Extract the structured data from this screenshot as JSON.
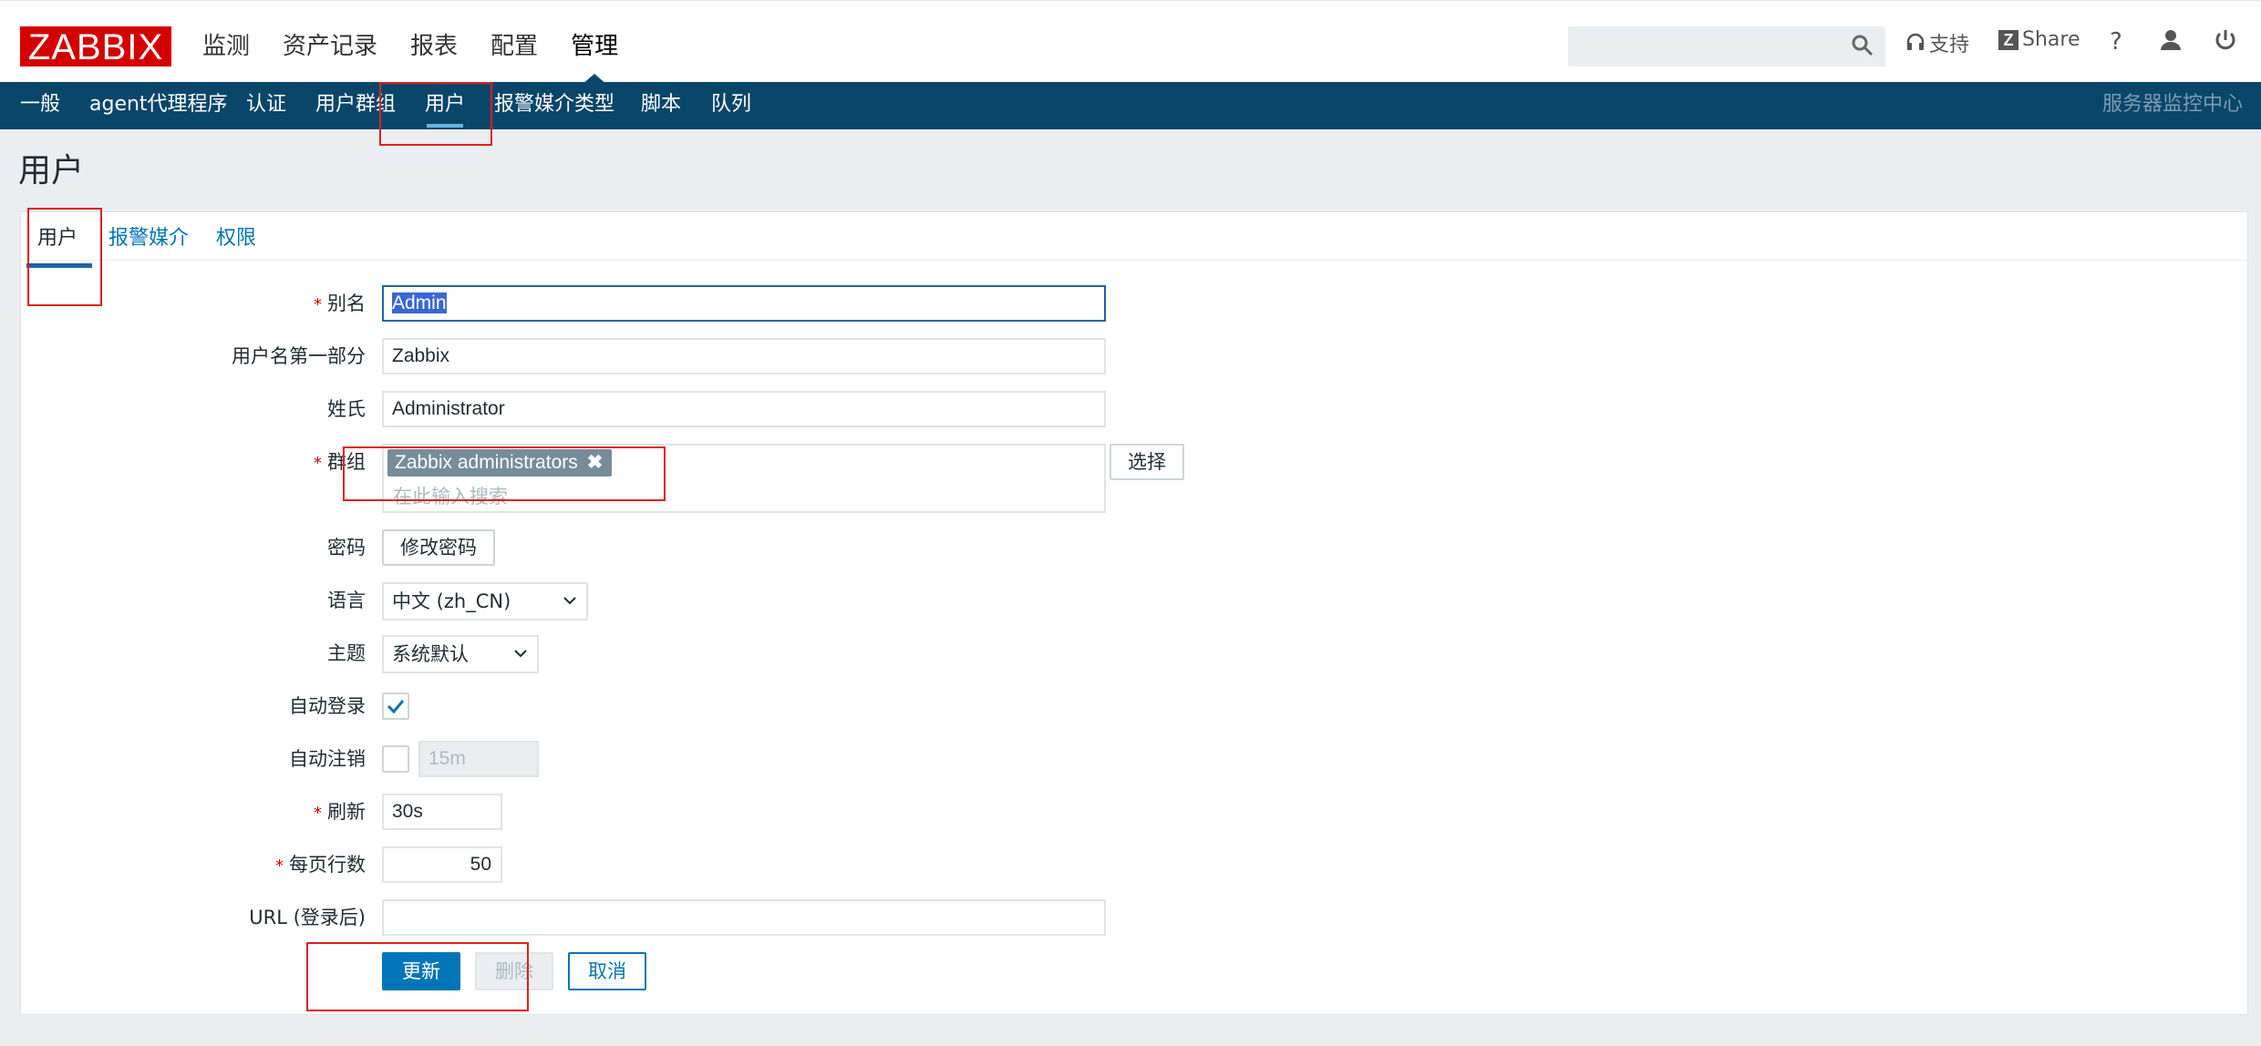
{
  "header": {
    "logo": "ZABBIX",
    "menu": [
      "监测",
      "资产记录",
      "报表",
      "配置",
      "管理"
    ],
    "active_menu": "管理",
    "support": "支持",
    "share": "Share",
    "help": "?"
  },
  "submenu": {
    "items": [
      "一般",
      "agent代理程序",
      "认证",
      "用户群组",
      "用户",
      "报警媒介类型",
      "脚本",
      "队列"
    ],
    "active": "用户",
    "server_name": "服务器监控中心"
  },
  "page": {
    "title": "用户"
  },
  "tabs": [
    "用户",
    "报警媒介",
    "权限"
  ],
  "form": {
    "alias_label": "别名",
    "alias_value": "Admin",
    "name_label": "用户名第一部分",
    "name_value": "Zabbix",
    "surname_label": "姓氏",
    "surname_value": "Administrator",
    "groups_label": "群组",
    "group_chip": "Zabbix administrators",
    "group_placeholder": "在此输入搜索",
    "select_button": "选择",
    "password_label": "密码",
    "change_password_button": "修改密码",
    "language_label": "语言",
    "language_value": "中文 (zh_CN)",
    "theme_label": "主题",
    "theme_value": "系统默认",
    "autologin_label": "自动登录",
    "autologin_checked": true,
    "autologout_label": "自动注销",
    "autologout_checked": false,
    "autologout_value": "15m",
    "refresh_label": "刷新",
    "refresh_value": "30s",
    "rows_label": "每页行数",
    "rows_value": "50",
    "url_label": "URL (登录后)",
    "url_value": "",
    "update_button": "更新",
    "delete_button": "删除",
    "cancel_button": "取消"
  },
  "colors": {
    "brand_red": "#d40000",
    "nav_blue": "#0a466a",
    "link_blue": "#0275b8",
    "highlight_red": "#e02020"
  }
}
